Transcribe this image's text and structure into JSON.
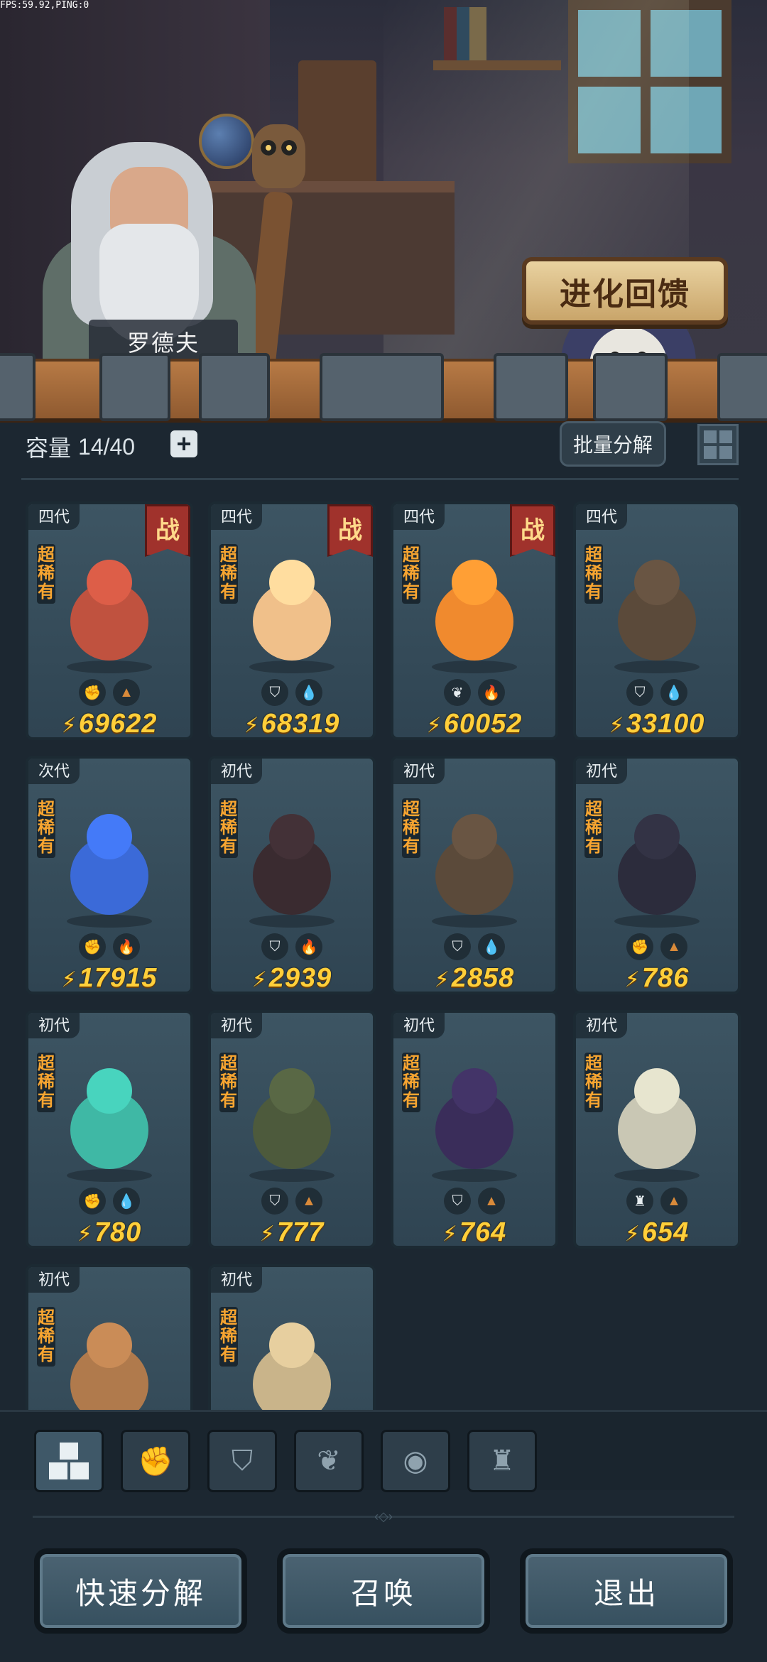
{
  "debug": {
    "fps_text": "FPS:59.92,PING:0"
  },
  "scene": {
    "npc_name": "罗德夫",
    "evolution_button": "进化回馈"
  },
  "inventory": {
    "capacity_label": "容量",
    "capacity_value": "14/40",
    "add_capacity_icon": "plus-icon",
    "batch_decompose_label": "批量分解",
    "view_toggle_icon": "grid-view-icon"
  },
  "cards": [
    {
      "generation": "四代",
      "rarity": "超稀有",
      "in_battle": true,
      "battle_label": "战",
      "class_icon": "fist-icon",
      "element_icon": "earth-icon",
      "power": "69622",
      "color": "#c0523f"
    },
    {
      "generation": "四代",
      "rarity": "超稀有",
      "in_battle": true,
      "battle_label": "战",
      "class_icon": "shield-icon",
      "element_icon": "water-icon",
      "power": "68319",
      "color": "#f0c08a"
    },
    {
      "generation": "四代",
      "rarity": "超稀有",
      "in_battle": true,
      "battle_label": "战",
      "class_icon": "leaf-icon",
      "element_icon": "fire-icon",
      "power": "60052",
      "color": "#f08a2e"
    },
    {
      "generation": "四代",
      "rarity": "超稀有",
      "in_battle": false,
      "battle_label": "",
      "class_icon": "shield-icon",
      "element_icon": "water-icon",
      "power": "33100",
      "color": "#5b4a3a"
    },
    {
      "generation": "次代",
      "rarity": "超稀有",
      "in_battle": false,
      "battle_label": "",
      "class_icon": "fist-icon",
      "element_icon": "fire-icon",
      "power": "17915",
      "color": "#3b6ad8"
    },
    {
      "generation": "初代",
      "rarity": "超稀有",
      "in_battle": false,
      "battle_label": "",
      "class_icon": "shield-icon",
      "element_icon": "fire-icon",
      "power": "2939",
      "color": "#3a2b30"
    },
    {
      "generation": "初代",
      "rarity": "超稀有",
      "in_battle": false,
      "battle_label": "",
      "class_icon": "shield-icon",
      "element_icon": "water-icon",
      "power": "2858",
      "color": "#5b4a3a"
    },
    {
      "generation": "初代",
      "rarity": "超稀有",
      "in_battle": false,
      "battle_label": "",
      "class_icon": "fist-icon",
      "element_icon": "earth-icon",
      "power": "786",
      "color": "#2c2c3c"
    },
    {
      "generation": "初代",
      "rarity": "超稀有",
      "in_battle": false,
      "battle_label": "",
      "class_icon": "fist-icon",
      "element_icon": "water-icon",
      "power": "780",
      "color": "#3fb8a5"
    },
    {
      "generation": "初代",
      "rarity": "超稀有",
      "in_battle": false,
      "battle_label": "",
      "class_icon": "shield-icon",
      "element_icon": "earth-icon",
      "power": "777",
      "color": "#4d5a3c"
    },
    {
      "generation": "初代",
      "rarity": "超稀有",
      "in_battle": false,
      "battle_label": "",
      "class_icon": "shield-icon",
      "element_icon": "earth-icon",
      "power": "764",
      "color": "#3a2d5a"
    },
    {
      "generation": "初代",
      "rarity": "超稀有",
      "in_battle": false,
      "battle_label": "",
      "class_icon": "tower-icon",
      "element_icon": "earth-icon",
      "power": "654",
      "color": "#c9c7b4"
    },
    {
      "generation": "初代",
      "rarity": "超稀有",
      "in_battle": false,
      "battle_label": "",
      "class_icon": "",
      "element_icon": "",
      "power": "",
      "color": "#b07a4c"
    },
    {
      "generation": "初代",
      "rarity": "超稀有",
      "in_battle": false,
      "battle_label": "",
      "class_icon": "",
      "element_icon": "",
      "power": "",
      "color": "#c9b48a"
    }
  ],
  "filters": [
    {
      "icon": "all-blocks-icon",
      "active": true
    },
    {
      "icon": "fist-icon",
      "active": false
    },
    {
      "icon": "shield-icon",
      "active": false
    },
    {
      "icon": "leaf-icon",
      "active": false
    },
    {
      "icon": "alien-head-icon",
      "active": false
    },
    {
      "icon": "tower-icon",
      "active": false
    }
  ],
  "actions": {
    "quick_decompose": "快速分解",
    "summon": "召唤",
    "exit": "退出"
  }
}
